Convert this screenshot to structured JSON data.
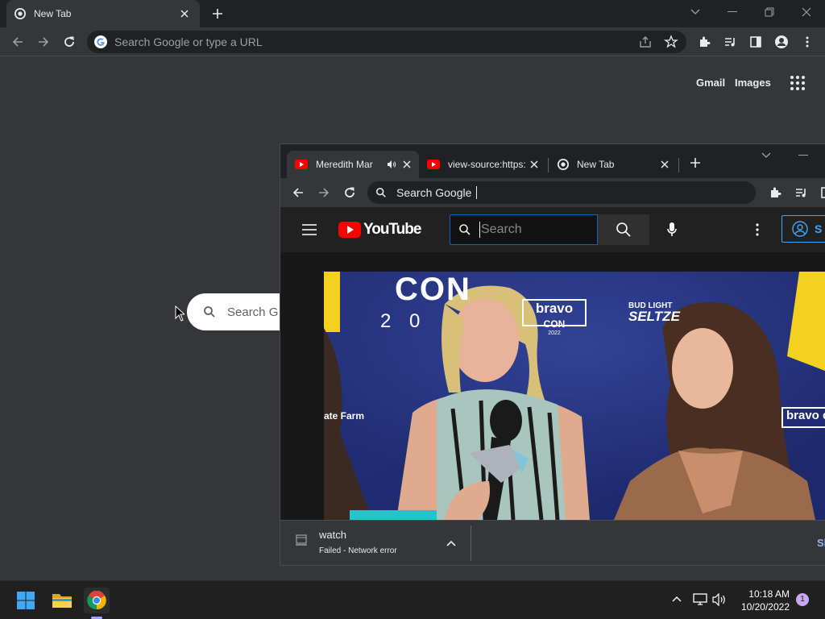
{
  "main_window": {
    "tab": {
      "title": "New Tab"
    },
    "omnibox": {
      "placeholder": "Search Google or type a URL"
    },
    "ntp": {
      "links": [
        "Gmail",
        "Images"
      ],
      "search_placeholder": "Search G"
    }
  },
  "second_window": {
    "tabs": [
      {
        "title": "Meredith Mar",
        "icon": "youtube-icon",
        "audio": true
      },
      {
        "title": "view-source:https:",
        "icon": "youtube-icon",
        "audio": false
      },
      {
        "title": "New Tab",
        "icon": "chrome-icon",
        "audio": false
      }
    ],
    "omnibox": {
      "text": "Search Google"
    },
    "youtube": {
      "logo_text": "YouTube",
      "search_placeholder": "Search",
      "signin_label": "S"
    },
    "video": {
      "sign_left_big": "CON",
      "sign_left_year": "2 0",
      "bravo_label": "bravo",
      "bravo_con": "CON",
      "bravo_year": "2022",
      "sponsor_line1": "BUD LIGHT",
      "sponsor_line2": "SELTZE",
      "farm_text": "ate Farm",
      "bravo_right": "bravo co"
    },
    "download": {
      "filename": "watch",
      "status": "Failed - Network error",
      "show_all": "Sh"
    }
  },
  "taskbar": {
    "time": "10:18 AM",
    "date": "10/20/2022",
    "notification_count": "1"
  },
  "colors": {
    "chrome_dark": "#202124",
    "chrome_toolbar": "#35363a",
    "youtube_red": "#ff0000",
    "accent_blue": "#3ea6ff"
  }
}
